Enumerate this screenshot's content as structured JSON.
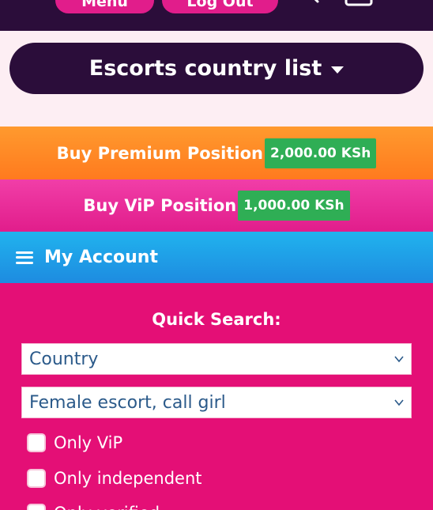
{
  "topbar": {
    "menu_label": "Menu",
    "logout_label": "Log Out",
    "search_icon": "search-icon",
    "cart_icon": "cart-icon"
  },
  "country_button": {
    "label": "Escorts country list",
    "icon": "caret-down-icon"
  },
  "premium": {
    "label": "Buy Premium Position",
    "price": "2,000.00 KSh"
  },
  "vip": {
    "label": "Buy ViP Position",
    "price": "1,000.00 KSh"
  },
  "account": {
    "label": "My Account",
    "icon": "hamburger-icon"
  },
  "quick_search": {
    "title": "Quick Search:",
    "country_select": {
      "value": "Country"
    },
    "type_select": {
      "value": "Female escort, call girl"
    },
    "checkboxes": [
      {
        "label": "Only ViP",
        "checked": false
      },
      {
        "label": "Only independent",
        "checked": false
      },
      {
        "label": "Only verified",
        "checked": false
      }
    ]
  },
  "colors": {
    "dark": "#2b0d3a",
    "pink": "#e40f76",
    "orange": "#ff8a26",
    "green": "#2fae55",
    "blue": "#1e9be6"
  }
}
